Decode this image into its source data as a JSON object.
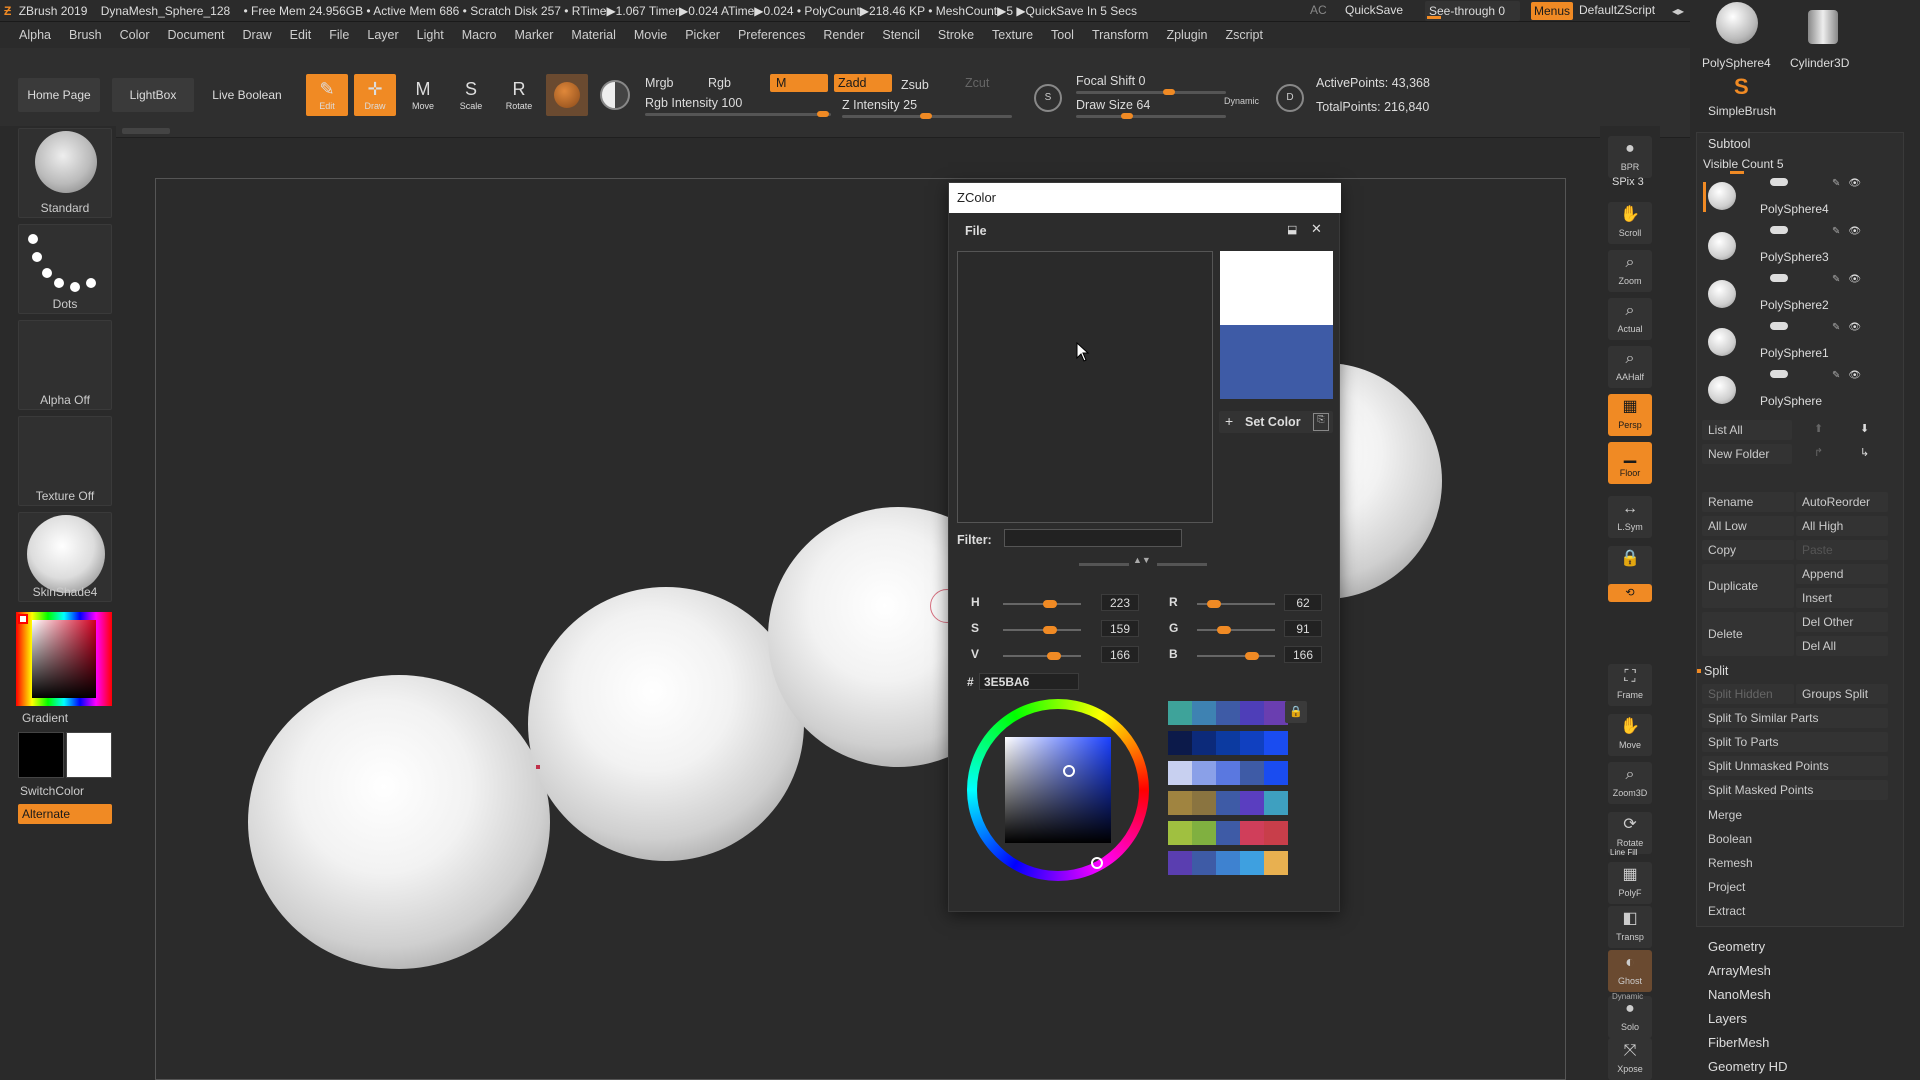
{
  "titlebar": {
    "app": "ZBrush 2019",
    "doc": "DynaMesh_Sphere_128",
    "status": "• Free Mem 24.956GB • Active Mem 686 • Scratch Disk 257 • RTime▶1.067 Timer▶0.024 ATime▶0.024 • PolyCount▶218.46 KP • MeshCount▶5 ▶QuickSave In 5 Secs",
    "ac": "AC",
    "quicksave": "QuickSave",
    "seethrough": "See-through 0",
    "menus": "Menus",
    "script": "DefaultZScript"
  },
  "menubar": [
    "Alpha",
    "Brush",
    "Color",
    "Document",
    "Draw",
    "Edit",
    "File",
    "Layer",
    "Light",
    "Macro",
    "Marker",
    "Material",
    "Movie",
    "Picker",
    "Preferences",
    "Render",
    "Stencil",
    "Stroke",
    "Texture",
    "Tool",
    "Transform",
    "Zplugin",
    "Zscript"
  ],
  "shelf": {
    "home": "Home Page",
    "lightbox": "LightBox",
    "liveboolean": "Live Boolean",
    "tools": [
      {
        "label": "Edit",
        "icon": "✎"
      },
      {
        "label": "Draw",
        "icon": "✛"
      },
      {
        "label": "Move",
        "icon": "M"
      },
      {
        "label": "Scale",
        "icon": "S"
      },
      {
        "label": "Rotate",
        "icon": "R"
      }
    ],
    "mrgb": "Mrgb",
    "rgb": "Rgb",
    "m": "M",
    "zadd": "Zadd",
    "zsub": "Zsub",
    "zcut": "Zcut",
    "rgb_intensity": "Rgb Intensity 100",
    "z_intensity": "Z Intensity 25",
    "focal_shift": "Focal Shift 0",
    "draw_size": "Draw Size 64",
    "dynamic": "Dynamic",
    "active_points": "ActivePoints: 43,368",
    "total_points": "TotalPoints: 216,840"
  },
  "left": {
    "brush": "Standard",
    "stroke": "Dots",
    "alpha": "Alpha Off",
    "texture": "Texture Off",
    "material": "SkinShade4",
    "gradient": "Gradient",
    "switchcolor": "SwitchColor",
    "alternate": "Alternate"
  },
  "rightstrip": [
    {
      "label": "BPR",
      "icon": "●"
    },
    {
      "label": "Scroll",
      "icon": "✋"
    },
    {
      "label": "Zoom",
      "icon": "⌕"
    },
    {
      "label": "Actual",
      "icon": "⌕"
    },
    {
      "label": "AAHalf",
      "icon": "⌕"
    },
    {
      "label": "Persp",
      "icon": "▦"
    },
    {
      "label": "Floor",
      "icon": "▁"
    },
    {
      "label": "L.Sym",
      "icon": "↔"
    },
    {
      "label": "",
      "icon": "🔒"
    },
    {
      "label": "Xyz",
      "icon": "⟲"
    },
    {
      "label": "Frame",
      "icon": "⛶"
    },
    {
      "label": "Move",
      "icon": "✋"
    },
    {
      "label": "Zoom3D",
      "icon": "⌕"
    },
    {
      "label": "Rotate",
      "icon": "⟳"
    },
    {
      "label": "PolyF",
      "icon": "▦"
    },
    {
      "label": "Transp",
      "icon": "◧"
    },
    {
      "label": "Ghost",
      "icon": "◐"
    },
    {
      "label": "Solo",
      "icon": "●"
    },
    {
      "label": "Xpose",
      "icon": "⤧"
    }
  ],
  "spix": "SPix 3",
  "linefill": "Line Fill",
  "dynamic2": "Dynamic",
  "subtool": {
    "top_tools": [
      "PolySphere4",
      "Cylinder3D",
      "SimpleBrush"
    ],
    "title": "Subtool",
    "visible_count": "Visible Count 5",
    "items": [
      "PolySphere4",
      "PolySphere3",
      "PolySphere2",
      "PolySphere1",
      "PolySphere"
    ],
    "list_all": "List All",
    "new_folder": "New Folder",
    "rename": "Rename",
    "autoreorder": "AutoReorder",
    "all_low": "All Low",
    "all_high": "All High",
    "copy": "Copy",
    "paste": "Paste",
    "append": "Append",
    "duplicate": "Duplicate",
    "insert": "Insert",
    "delete": "Delete",
    "del_other": "Del Other",
    "del_all": "Del All",
    "split": "Split",
    "split_hidden": "Split Hidden",
    "groups_split": "Groups Split",
    "split_similar": "Split To Similar Parts",
    "split_parts": "Split To Parts",
    "split_unmasked": "Split Unmasked Points",
    "split_masked": "Split Masked Points",
    "merge": "Merge",
    "boolean": "Boolean",
    "remesh": "Remesh",
    "project": "Project",
    "extract": "Extract"
  },
  "tool_groups": [
    "Geometry",
    "ArrayMesh",
    "NanoMesh",
    "Layers",
    "FiberMesh",
    "Geometry HD"
  ],
  "zcolor": {
    "title": "ZColor",
    "file": "File",
    "filter": "Filter:",
    "setcolor": "Set Color",
    "h_label": "H",
    "h": "223",
    "s_label": "S",
    "s": "159",
    "v_label": "V",
    "v": "166",
    "r_label": "R",
    "r": "62",
    "g_label": "G",
    "g": "91",
    "b_label": "B",
    "b": "166",
    "hash": "#",
    "hex": "3E5BA6",
    "primary": "#ffffff",
    "secondary": "#3e5ba6",
    "palette": [
      [
        "#3ea39a",
        "#3e82b2",
        "#3e5ba6",
        "#4e3eb8",
        "#6a3eb0"
      ],
      [
        "#0c1a4a",
        "#0c2a7a",
        "#0c3aa0",
        "#1040c0",
        "#1a4cf0"
      ],
      [
        "#c8d0f0",
        "#8aa0e8",
        "#5a78e0",
        "#3e5ba6",
        "#1a4cf0"
      ],
      [
        "#a08440",
        "#8a7440",
        "#3e5ba6",
        "#5a3ec0",
        "#3ea0c0"
      ],
      [
        "#a0c040",
        "#80b040",
        "#3e5ba6",
        "#d03e5a",
        "#c83e4a"
      ],
      [
        "#5a3eb0",
        "#3e5ba6",
        "#3e82d0",
        "#3ea0e0",
        "#e8b050"
      ]
    ]
  }
}
